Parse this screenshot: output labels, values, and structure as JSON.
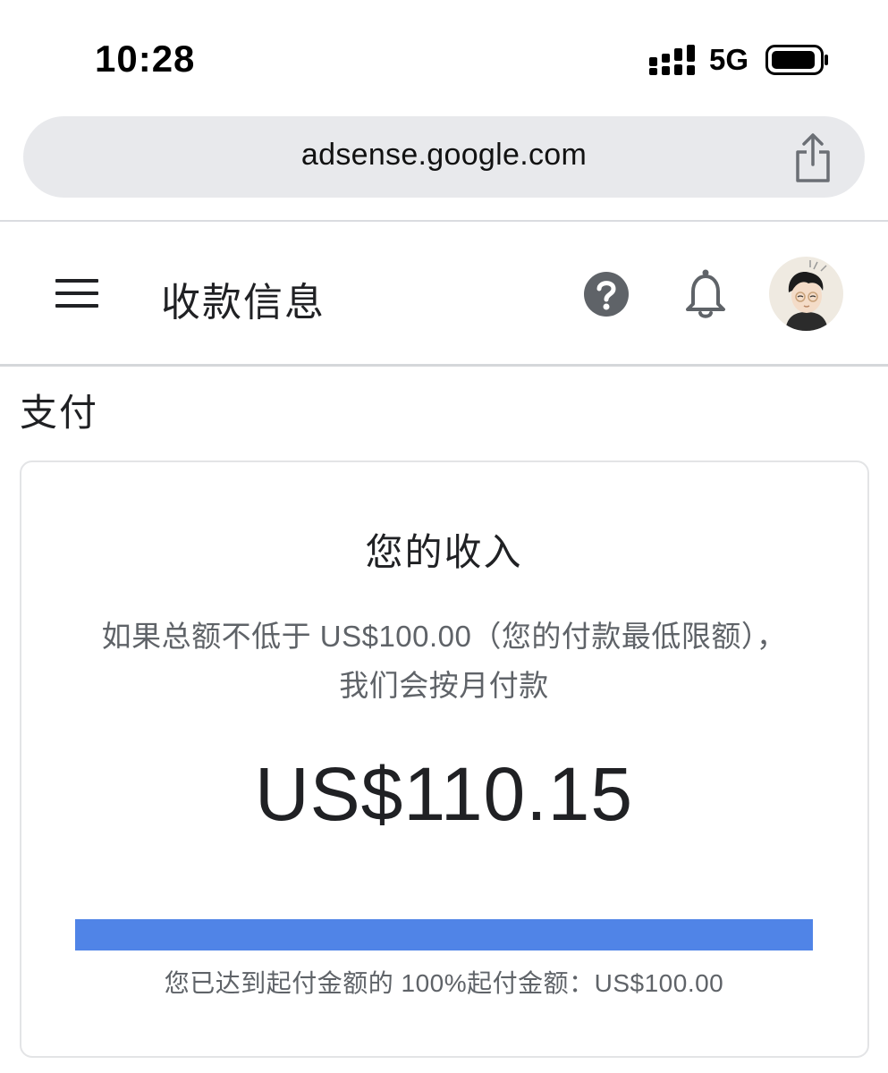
{
  "status_bar": {
    "time": "10:28",
    "network": "5G"
  },
  "browser": {
    "url": "adsense.google.com"
  },
  "header": {
    "title": "收款信息",
    "icons": [
      "menu-icon",
      "help-icon",
      "bell-icon",
      "avatar"
    ]
  },
  "section": {
    "title": "支付"
  },
  "earnings_card": {
    "title": "您的收入",
    "description": "如果总额不低于 US$100.00（您的付款最低限额），我们会按月付款",
    "amount": "US$110.15",
    "progress_percent": 100,
    "progress_caption": "您已达到起付金额的 100%起付金额：US$100.00"
  },
  "colors": {
    "progress": "#5084e7",
    "url_bar": "#e8e9ec",
    "icon_gray": "#5f6368"
  }
}
